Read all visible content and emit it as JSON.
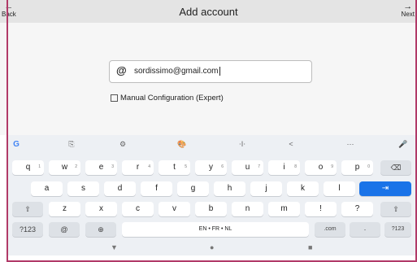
{
  "appbar": {
    "back_label": "Back",
    "next_label": "Next",
    "title": "Add account",
    "back_arrow": "←",
    "next_arrow": "→"
  },
  "form": {
    "email_icon": "@",
    "email_value": "sordissimo@gmail.com",
    "manual_config_label": "Manual Configuration (Expert)"
  },
  "keyboard": {
    "toolbar": [
      "G",
      "⎘",
      "⚙",
      "🎨",
      "⋅I⋅",
      "<",
      "⋯",
      "🎤"
    ],
    "row1": [
      {
        "k": "q",
        "n": "1"
      },
      {
        "k": "w",
        "n": "2"
      },
      {
        "k": "e",
        "n": "3"
      },
      {
        "k": "r",
        "n": "4"
      },
      {
        "k": "t",
        "n": "5"
      },
      {
        "k": "y",
        "n": "6"
      },
      {
        "k": "u",
        "n": "7"
      },
      {
        "k": "i",
        "n": "8"
      },
      {
        "k": "o",
        "n": "9"
      },
      {
        "k": "p",
        "n": "0"
      }
    ],
    "backspace": "⌫",
    "row2": [
      "a",
      "s",
      "d",
      "f",
      "g",
      "h",
      "j",
      "k",
      "l"
    ],
    "enter": "⇥",
    "shift": "⇧",
    "row3": [
      "z",
      "x",
      "c",
      "v",
      "b",
      "n",
      "m",
      "!",
      "?"
    ],
    "row4": {
      "sym_left": "?123",
      "at": "@",
      "globe": "⊕",
      "space": "EN • FR • NL",
      "dotcom": ".com",
      "dot": "·",
      "sym_right": "?123"
    },
    "nav": [
      "▼",
      "●",
      "■"
    ]
  }
}
